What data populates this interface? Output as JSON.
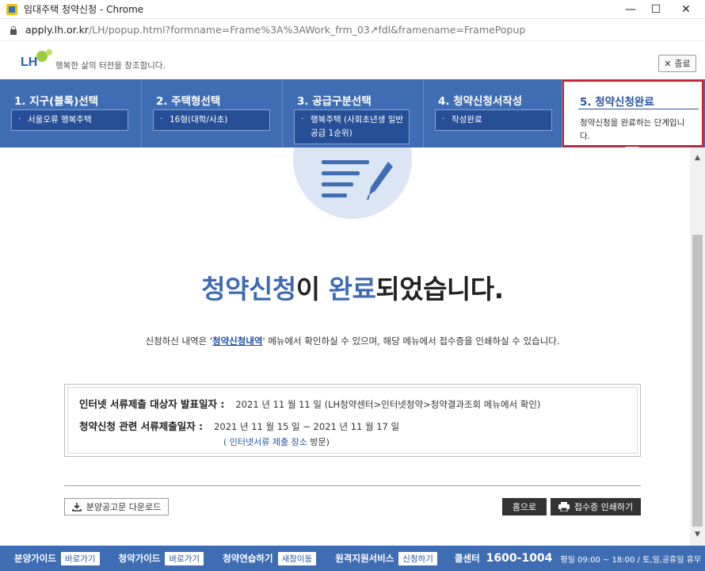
{
  "window": {
    "title": "임대주택 청약신청 - Chrome",
    "controls": {
      "minimize": "—",
      "maximize": "☐",
      "close": "✕"
    }
  },
  "address_bar": {
    "url_host": "apply.lh.or.kr",
    "url_path": "/LH/popup.html?formname=Frame%3A%3AWork_frm_03↗fdl&framename=FramePopup"
  },
  "header": {
    "logo_text": "LH",
    "slogan": "행복한 삶의 터전을 창조합니다.",
    "close_button": "종료"
  },
  "steps": [
    {
      "title": "1. 지구(블록)선택",
      "detail": "서울오류 행복주택"
    },
    {
      "title": "2. 주택형선택",
      "detail": "16형(대학/사초)"
    },
    {
      "title": "3. 공급구분선택",
      "detail": "행복주택 (사회초년생 일반공급 1순위)"
    },
    {
      "title": "4. 청약신청서작성",
      "detail": "작성완료"
    },
    {
      "title": "5. 청약신청완료",
      "detail": "청약신청을 완료하는 단계입니다."
    }
  ],
  "main": {
    "title_hl1": "청약신청",
    "title_mid": "이 ",
    "title_hl2": "완료",
    "title_end": "되었습니다.",
    "guide_before": "신청하신 내역은 '",
    "guide_link": "청약신청내역",
    "guide_after": "' 메뉴에서 확인하실 수 있으며, 해당 메뉴에서 접수증을 인쇄하실 수 있습니다."
  },
  "info": {
    "announce_label": "인터넷 서류제출 대상자 발표일자 :",
    "announce_value": "2021 년 11 월 11 일 (LH청약센터>인터넷청약>청약결과조회 메뉴에서 확인)",
    "submit_label": "청약신청 관련 서류제출일자 :",
    "submit_value": "2021 년 11 월 15 일 ~ 2021 년 11 월 17 일",
    "place_open": "( ",
    "place_link": "인터넷서류 제출 장소",
    "place_close": " 방문)"
  },
  "buttons": {
    "download": "분양공고문 다운로드",
    "home": "홈으로",
    "print": "접수증 인쇄하기"
  },
  "footer": {
    "items": [
      {
        "label": "분양가이드",
        "badge": "바로가기"
      },
      {
        "label": "청약가이드",
        "badge": "바로가기"
      },
      {
        "label": "청약연습하기",
        "badge": "새창이동"
      },
      {
        "label": "원격지원서비스",
        "badge": "신청하기"
      }
    ],
    "call_label": "콜센터",
    "call_number": "1600-1004",
    "hours": "평일 09:00 ~ 18:00 / 토,일,공휴일 휴무"
  },
  "colors": {
    "brand_blue": "#3f6db3",
    "highlight_red": "#e0161e",
    "dark_button": "#333333"
  }
}
